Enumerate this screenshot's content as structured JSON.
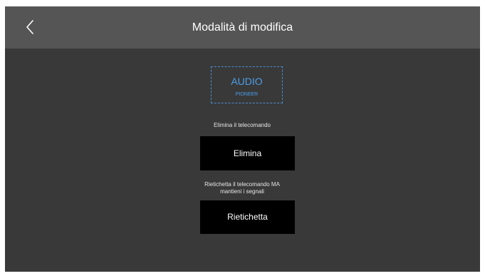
{
  "header": {
    "back_icon": "chevron-left-icon",
    "title": "Modalità di modifica"
  },
  "device": {
    "name": "AUDIO",
    "brand": "PIONEER"
  },
  "delete_section": {
    "caption": "Elimina il telecomando",
    "button_label": "Elimina"
  },
  "relabel_section": {
    "caption_line1": "Rietichetta il telecomando MA",
    "caption_line2": "mantieni i segnali",
    "button_label": "Rietichetta"
  },
  "colors": {
    "header_bg": "#555555",
    "main_bg": "#393939",
    "accent": "#4a9ee8",
    "button_bg": "#000000"
  }
}
